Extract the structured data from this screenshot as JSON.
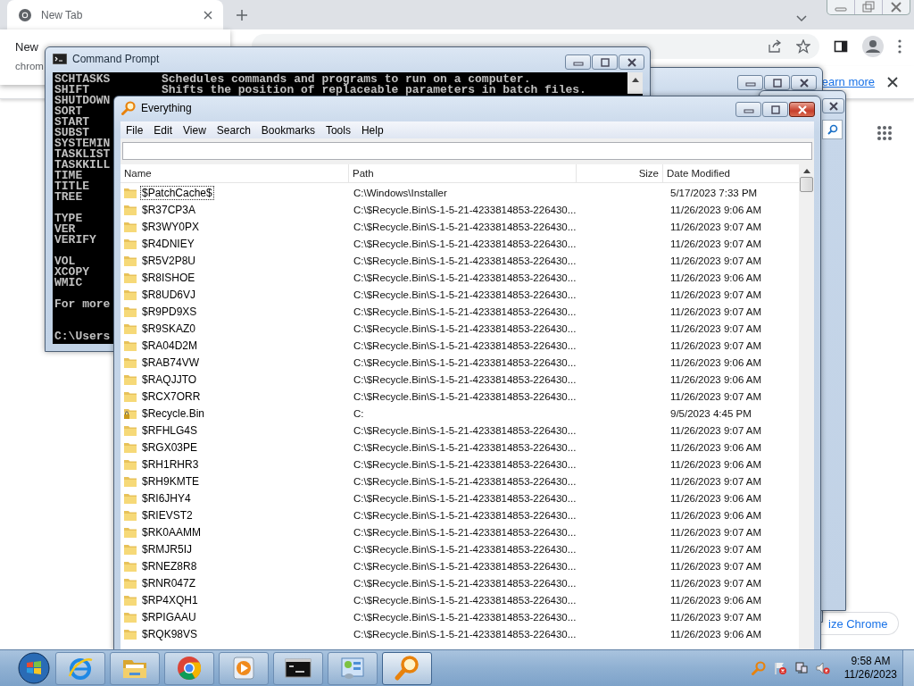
{
  "browser": {
    "tab": {
      "title": "New Tab",
      "selected": true
    },
    "tab_popup": {
      "title": "New",
      "subtitle": "chrom"
    },
    "infobar": {
      "link": "earn more"
    },
    "customize_button": "ize Chrome"
  },
  "command_prompt": {
    "title": "Command Prompt",
    "blocks": [
      {
        "kind": "output",
        "lines": [
          {
            "command": "SCHTASKS",
            "description": "Schedules commands and programs to run on a computer."
          },
          {
            "command": "SHIFT",
            "description": "Shifts the position of replaceable parameters in batch files."
          },
          {
            "command": "SHUTDOWN"
          },
          {
            "command": "SORT"
          },
          {
            "command": "START"
          },
          {
            "command": "SUBST"
          },
          {
            "command": "SYSTEMIN"
          },
          {
            "command": "TASKLIST"
          },
          {
            "command": "TASKKILL"
          },
          {
            "command": "TIME"
          },
          {
            "command": "TITLE"
          },
          {
            "command": "TREE"
          }
        ]
      },
      {
        "kind": "output",
        "lines": [
          {
            "command": "TYPE"
          },
          {
            "command": "VER"
          },
          {
            "command": "VERIFY"
          }
        ]
      },
      {
        "kind": "output",
        "lines": [
          {
            "command": "VOL"
          },
          {
            "command": "XCOPY"
          },
          {
            "command": "WMIC"
          }
        ]
      },
      {
        "kind": "output",
        "lines": [
          {
            "command": "For more"
          }
        ]
      },
      {
        "kind": "prompt",
        "lines": [
          {
            "command": "C:\\Users"
          }
        ]
      }
    ]
  },
  "everything": {
    "title": "Everything",
    "menu": [
      "File",
      "Edit",
      "View",
      "Search",
      "Bookmarks",
      "Tools",
      "Help"
    ],
    "columns": [
      "Name",
      "Path",
      "Size",
      "Date Modified"
    ],
    "rows": [
      {
        "name": "$PatchCache$",
        "path": "C:\\Windows\\Installer",
        "date": "5/17/2023 7:33 PM",
        "kind": "folder",
        "selected": true
      },
      {
        "name": "$R37CP3A",
        "path": "C:\\$Recycle.Bin\\S-1-5-21-4233814853-226430...",
        "date": "11/26/2023 9:06 AM",
        "kind": "folder",
        "selected": false
      },
      {
        "name": "$R3WY0PX",
        "path": "C:\\$Recycle.Bin\\S-1-5-21-4233814853-226430...",
        "date": "11/26/2023 9:07 AM",
        "kind": "folder",
        "selected": false
      },
      {
        "name": "$R4DNIEY",
        "path": "C:\\$Recycle.Bin\\S-1-5-21-4233814853-226430...",
        "date": "11/26/2023 9:07 AM",
        "kind": "folder",
        "selected": false
      },
      {
        "name": "$R5V2P8U",
        "path": "C:\\$Recycle.Bin\\S-1-5-21-4233814853-226430...",
        "date": "11/26/2023 9:07 AM",
        "kind": "folder",
        "selected": false
      },
      {
        "name": "$R8ISHOE",
        "path": "C:\\$Recycle.Bin\\S-1-5-21-4233814853-226430...",
        "date": "11/26/2023 9:06 AM",
        "kind": "folder",
        "selected": false
      },
      {
        "name": "$R8UD6VJ",
        "path": "C:\\$Recycle.Bin\\S-1-5-21-4233814853-226430...",
        "date": "11/26/2023 9:07 AM",
        "kind": "folder",
        "selected": false
      },
      {
        "name": "$R9PD9XS",
        "path": "C:\\$Recycle.Bin\\S-1-5-21-4233814853-226430...",
        "date": "11/26/2023 9:07 AM",
        "kind": "folder",
        "selected": false
      },
      {
        "name": "$R9SKAZ0",
        "path": "C:\\$Recycle.Bin\\S-1-5-21-4233814853-226430...",
        "date": "11/26/2023 9:07 AM",
        "kind": "folder",
        "selected": false
      },
      {
        "name": "$RA04D2M",
        "path": "C:\\$Recycle.Bin\\S-1-5-21-4233814853-226430...",
        "date": "11/26/2023 9:07 AM",
        "kind": "folder",
        "selected": false
      },
      {
        "name": "$RAB74VW",
        "path": "C:\\$Recycle.Bin\\S-1-5-21-4233814853-226430...",
        "date": "11/26/2023 9:06 AM",
        "kind": "folder",
        "selected": false
      },
      {
        "name": "$RAQJJTO",
        "path": "C:\\$Recycle.Bin\\S-1-5-21-4233814853-226430...",
        "date": "11/26/2023 9:06 AM",
        "kind": "folder",
        "selected": false
      },
      {
        "name": "$RCX7ORR",
        "path": "C:\\$Recycle.Bin\\S-1-5-21-4233814853-226430...",
        "date": "11/26/2023 9:07 AM",
        "kind": "folder",
        "selected": false
      },
      {
        "name": "$Recycle.Bin",
        "path": "C:",
        "date": "9/5/2023 4:45 PM",
        "kind": "locked-folder",
        "selected": false
      },
      {
        "name": "$RFHLG4S",
        "path": "C:\\$Recycle.Bin\\S-1-5-21-4233814853-226430...",
        "date": "11/26/2023 9:07 AM",
        "kind": "folder",
        "selected": false
      },
      {
        "name": "$RGX03PE",
        "path": "C:\\$Recycle.Bin\\S-1-5-21-4233814853-226430...",
        "date": "11/26/2023 9:06 AM",
        "kind": "folder",
        "selected": false
      },
      {
        "name": "$RH1RHR3",
        "path": "C:\\$Recycle.Bin\\S-1-5-21-4233814853-226430...",
        "date": "11/26/2023 9:06 AM",
        "kind": "folder",
        "selected": false
      },
      {
        "name": "$RH9KMTE",
        "path": "C:\\$Recycle.Bin\\S-1-5-21-4233814853-226430...",
        "date": "11/26/2023 9:07 AM",
        "kind": "folder",
        "selected": false
      },
      {
        "name": "$RI6JHY4",
        "path": "C:\\$Recycle.Bin\\S-1-5-21-4233814853-226430...",
        "date": "11/26/2023 9:06 AM",
        "kind": "folder",
        "selected": false
      },
      {
        "name": "$RIEVST2",
        "path": "C:\\$Recycle.Bin\\S-1-5-21-4233814853-226430...",
        "date": "11/26/2023 9:06 AM",
        "kind": "folder",
        "selected": false
      },
      {
        "name": "$RK0AAMM",
        "path": "C:\\$Recycle.Bin\\S-1-5-21-4233814853-226430...",
        "date": "11/26/2023 9:07 AM",
        "kind": "folder",
        "selected": false
      },
      {
        "name": "$RMJR5IJ",
        "path": "C:\\$Recycle.Bin\\S-1-5-21-4233814853-226430...",
        "date": "11/26/2023 9:07 AM",
        "kind": "folder",
        "selected": false
      },
      {
        "name": "$RNEZ8R8",
        "path": "C:\\$Recycle.Bin\\S-1-5-21-4233814853-226430...",
        "date": "11/26/2023 9:07 AM",
        "kind": "folder",
        "selected": false
      },
      {
        "name": "$RNR047Z",
        "path": "C:\\$Recycle.Bin\\S-1-5-21-4233814853-226430...",
        "date": "11/26/2023 9:07 AM",
        "kind": "folder",
        "selected": false
      },
      {
        "name": "$RP4XQH1",
        "path": "C:\\$Recycle.Bin\\S-1-5-21-4233814853-226430...",
        "date": "11/26/2023 9:06 AM",
        "kind": "folder",
        "selected": false
      },
      {
        "name": "$RPIGAAU",
        "path": "C:\\$Recycle.Bin\\S-1-5-21-4233814853-226430...",
        "date": "11/26/2023 9:07 AM",
        "kind": "folder",
        "selected": false
      },
      {
        "name": "$RQK98VS",
        "path": "C:\\$Recycle.Bin\\S-1-5-21-4233814853-226430...",
        "date": "11/26/2023 9:06 AM",
        "kind": "folder",
        "selected": false
      }
    ]
  },
  "taskbar": {
    "apps": [
      {
        "kind": "browser-e",
        "active": false
      },
      {
        "kind": "folders",
        "active": false
      },
      {
        "kind": "browser-round",
        "active": false
      },
      {
        "kind": "media",
        "active": false
      },
      {
        "kind": "console",
        "active": false
      },
      {
        "kind": "panel",
        "active": false
      },
      {
        "kind": "magnifier",
        "active": true
      }
    ],
    "clock": {
      "time": "9:58 AM",
      "date": "11/26/2023"
    }
  }
}
